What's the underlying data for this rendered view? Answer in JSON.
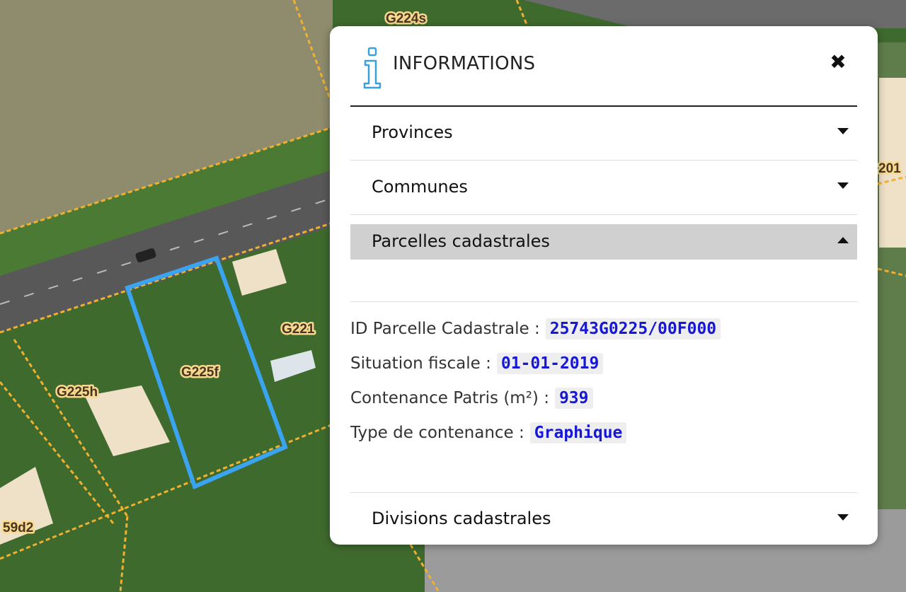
{
  "map": {
    "labels": [
      {
        "id": "g224s",
        "text": "G224s"
      },
      {
        "id": "g225f",
        "text": "G225f"
      },
      {
        "id": "g225h",
        "text": "G225h"
      },
      {
        "id": "g221",
        "text": "G221"
      },
      {
        "id": "59d2",
        "text": "59d2"
      },
      {
        "id": "201",
        "text": "201"
      }
    ],
    "colors": {
      "field": "#8f8f6f",
      "grass": "#3e6a2c",
      "road": "#555555",
      "parcel_line": "#f0b030",
      "selected_parcel": "#3ba4f0",
      "roof": "#efe0c8"
    }
  },
  "panel": {
    "title": "INFORMATIONS",
    "icon": "info-icon",
    "close_icon": "close-icon",
    "sections": [
      {
        "label": "Provinces",
        "expanded": false
      },
      {
        "label": "Communes",
        "expanded": false
      },
      {
        "label": "Parcelles cadastrales",
        "expanded": true
      },
      {
        "label": "Divisions cadastrales",
        "expanded": false
      }
    ],
    "attributes": [
      {
        "label": "ID Parcelle Cadastrale :",
        "value": "25743G0225/00F000"
      },
      {
        "label": "Situation fiscale :",
        "value": "01-01-2019"
      },
      {
        "label": "Contenance Patris (m²) :",
        "value": "939"
      },
      {
        "label": "Type de contenance :",
        "value": "Graphique"
      }
    ]
  }
}
